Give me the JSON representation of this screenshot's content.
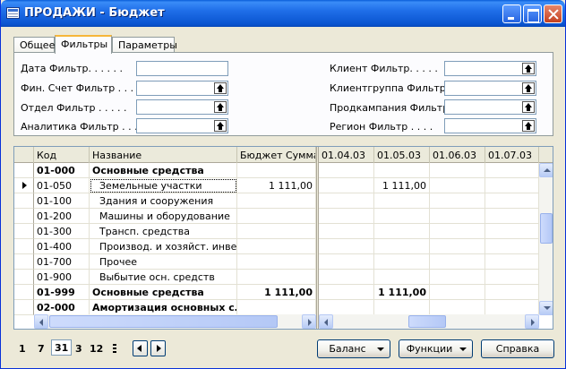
{
  "window": {
    "title": "ПРОДАЖИ - Бюджет"
  },
  "tabs": [
    {
      "label": "Общее"
    },
    {
      "label": "Фильтры"
    },
    {
      "label": "Параметры"
    }
  ],
  "filters": {
    "left": [
      {
        "label": "Дата Фильтр. . . . . .",
        "value": ""
      },
      {
        "label": "Фин. Счет Фильтр . . .",
        "value": ""
      },
      {
        "label": "Отдел Фильтр . . . . .",
        "value": ""
      },
      {
        "label": "Аналитика Фильтр . . .",
        "value": ""
      }
    ],
    "right": [
      {
        "label": "Клиент Фильтр. . . . .",
        "value": ""
      },
      {
        "label": "Клиентгруппа Фильтр .",
        "value": ""
      },
      {
        "label": "Продкампания Фильтр .",
        "value": ""
      },
      {
        "label": "Регион Фильтр . . . .",
        "value": ""
      }
    ]
  },
  "grid": {
    "columns": {
      "code": "Код",
      "name": "Название",
      "budget": "Бюджет Сумма"
    },
    "period_columns": [
      "01.04.03",
      "01.05.03",
      "01.06.03",
      "01.07.03"
    ],
    "rows": [
      {
        "code": "01-000",
        "name": "Основные средства",
        "budget": "",
        "p": [
          "",
          "",
          "",
          ""
        ],
        "bold": true,
        "indent": false,
        "current": false
      },
      {
        "code": "01-050",
        "name": "Земельные участки",
        "budget": "1 111,00",
        "p": [
          "",
          "1 111,00",
          "",
          ""
        ],
        "bold": false,
        "indent": true,
        "current": true
      },
      {
        "code": "01-100",
        "name": "Здания и сооружения",
        "budget": "",
        "p": [
          "",
          "",
          "",
          ""
        ],
        "bold": false,
        "indent": true,
        "current": false
      },
      {
        "code": "01-200",
        "name": "Машины и оборудование",
        "budget": "",
        "p": [
          "",
          "",
          "",
          ""
        ],
        "bold": false,
        "indent": true,
        "current": false
      },
      {
        "code": "01-300",
        "name": "Трансп. средства",
        "budget": "",
        "p": [
          "",
          "",
          "",
          ""
        ],
        "bold": false,
        "indent": true,
        "current": false
      },
      {
        "code": "01-400",
        "name": "Производ. и хозяйст. инве…",
        "budget": "",
        "p": [
          "",
          "",
          "",
          ""
        ],
        "bold": false,
        "indent": true,
        "current": false
      },
      {
        "code": "01-700",
        "name": "Прочее",
        "budget": "",
        "p": [
          "",
          "",
          "",
          ""
        ],
        "bold": false,
        "indent": true,
        "current": false
      },
      {
        "code": "01-900",
        "name": "Выбытие осн. средств",
        "budget": "",
        "p": [
          "",
          "",
          "",
          ""
        ],
        "bold": false,
        "indent": true,
        "current": false
      },
      {
        "code": "01-999",
        "name": "Основные средства",
        "budget": "1 111,00",
        "p": [
          "",
          "1 111,00",
          "",
          ""
        ],
        "bold": true,
        "indent": false,
        "current": false
      },
      {
        "code": "02-000",
        "name": "Амортизация основных с…",
        "budget": "",
        "p": [
          "",
          "",
          "",
          ""
        ],
        "bold": true,
        "indent": false,
        "current": false
      }
    ]
  },
  "period_nav": {
    "items": [
      "1",
      "7",
      "31",
      "3",
      "12"
    ],
    "selected_index": 2
  },
  "buttons": {
    "balance": "Баланс",
    "functions": "Функции",
    "help": "Справка"
  }
}
